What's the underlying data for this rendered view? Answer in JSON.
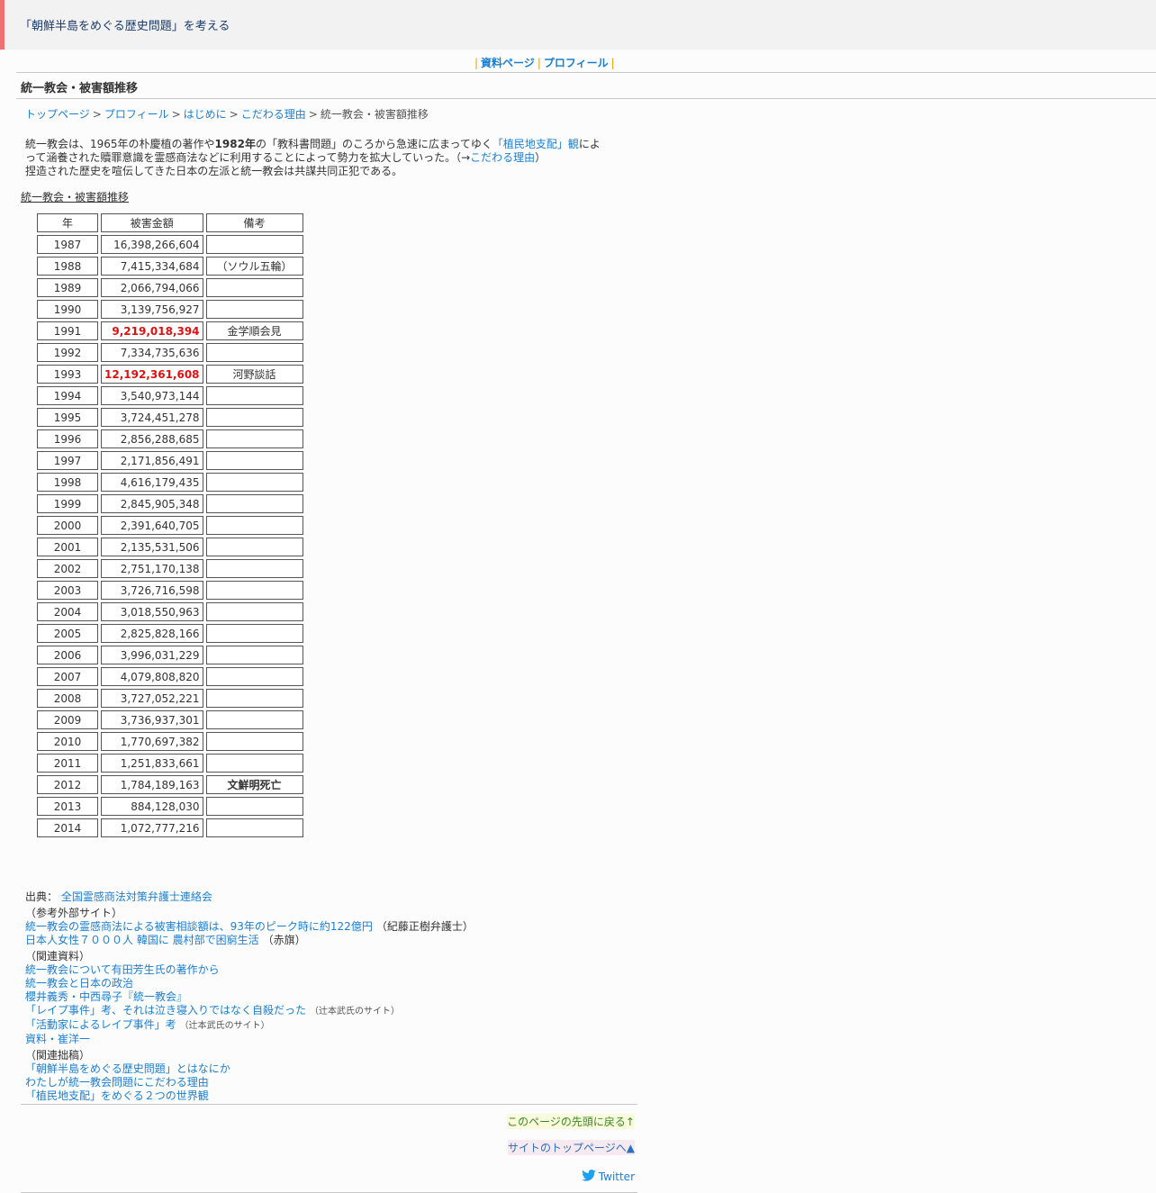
{
  "site": {
    "title": "「朝鮮半島をめぐる歴史問題」を考える"
  },
  "nav": {
    "sep": "|",
    "items": [
      "資料ページ",
      "プロフィール"
    ]
  },
  "page": {
    "heading": "統一教会・被害額推移"
  },
  "breadcrumb": {
    "sep": ">",
    "items": [
      "トップページ",
      "プロフィール",
      "はじめに",
      "こだわる理由"
    ],
    "current": "統一教会・被害額推移"
  },
  "intro": {
    "t1": "統一教会は、1965年の朴慶植の著作や",
    "b1": "1982年",
    "t2": "の「教科書問題」のころから急速に広まってゆく",
    "link1": "「植民地支配」観",
    "t3": "によって涵養された贖罪意識を霊感商法などに利用することによって勢力を拡大していった。（→",
    "link2": "こだわる理由",
    "t4": "）",
    "line3": "捏造された歴史を喧伝してきた日本の左派と統一教会は共謀共同正犯である。"
  },
  "table": {
    "caption": "統一教会・被害額推移",
    "headers": [
      "年",
      "被害金額",
      "備考"
    ],
    "rows": [
      {
        "year": "1987",
        "amount": "16,398,266,604",
        "note": ""
      },
      {
        "year": "1988",
        "amount": "7,415,334,684",
        "note": "（ソウル五輪）"
      },
      {
        "year": "1989",
        "amount": "2,066,794,066",
        "note": ""
      },
      {
        "year": "1990",
        "amount": "3,139,756,927",
        "note": ""
      },
      {
        "year": "1991",
        "amount": "9,219,018,394",
        "note": "金学順会見",
        "highlight": true
      },
      {
        "year": "1992",
        "amount": "7,334,735,636",
        "note": ""
      },
      {
        "year": "1993",
        "amount": "12,192,361,608",
        "note": "河野談話",
        "highlight": true
      },
      {
        "year": "1994",
        "amount": "3,540,973,144",
        "note": ""
      },
      {
        "year": "1995",
        "amount": "3,724,451,278",
        "note": ""
      },
      {
        "year": "1996",
        "amount": "2,856,288,685",
        "note": ""
      },
      {
        "year": "1997",
        "amount": "2,171,856,491",
        "note": ""
      },
      {
        "year": "1998",
        "amount": "4,616,179,435",
        "note": ""
      },
      {
        "year": "1999",
        "amount": "2,845,905,348",
        "note": ""
      },
      {
        "year": "2000",
        "amount": "2,391,640,705",
        "note": ""
      },
      {
        "year": "2001",
        "amount": "2,135,531,506",
        "note": ""
      },
      {
        "year": "2002",
        "amount": "2,751,170,138",
        "note": ""
      },
      {
        "year": "2003",
        "amount": "3,726,716,598",
        "note": ""
      },
      {
        "year": "2004",
        "amount": "3,018,550,963",
        "note": ""
      },
      {
        "year": "2005",
        "amount": "2,825,828,166",
        "note": ""
      },
      {
        "year": "2006",
        "amount": "3,996,031,229",
        "note": ""
      },
      {
        "year": "2007",
        "amount": "4,079,808,820",
        "note": ""
      },
      {
        "year": "2008",
        "amount": "3,727,052,221",
        "note": ""
      },
      {
        "year": "2009",
        "amount": "3,736,937,301",
        "note": ""
      },
      {
        "year": "2010",
        "amount": "1,770,697,382",
        "note": ""
      },
      {
        "year": "2011",
        "amount": "1,251,833,661",
        "note": ""
      },
      {
        "year": "2012",
        "amount": "1,784,189,163",
        "note": "文鮮明死亡",
        "note_bold": true
      },
      {
        "year": "2013",
        "amount": "884,128,030",
        "note": ""
      },
      {
        "year": "2014",
        "amount": "1,072,777,216",
        "note": ""
      }
    ]
  },
  "refs": {
    "source_label": "出典：",
    "source_link": "全国霊感商法対策弁護士連絡会",
    "external_label": "（参考外部サイト）",
    "external": [
      {
        "link": "統一教会の霊感商法による被害相談額は、93年のピーク時に約122億円",
        "note": "（紀藤正樹弁護士）"
      },
      {
        "link": "日本人女性７０００人 韓国に 農村部で困窮生活",
        "note": "（赤旗）"
      }
    ],
    "related_label": "（関連資料）",
    "related": [
      {
        "link": "統一教会について有田芳生氏の著作から",
        "note": ""
      },
      {
        "link": "統一教会と日本の政治",
        "note": ""
      },
      {
        "link": "櫻井義秀・中西尋子『統一教会』",
        "note": ""
      },
      {
        "link": "「レイプ事件」考、それは泣き寝入りではなく自殺だった",
        "note": "（辻本武氏のサイト）"
      },
      {
        "link": "「活動家によるレイプ事件」考",
        "note": "（辻本武氏のサイト）"
      },
      {
        "link": "資料・崔洋一",
        "note": ""
      }
    ],
    "essays_label": "（関連拙稿）",
    "essays": [
      "「朝鮮半島をめぐる歴史問題」とはなにか",
      "わたしが統一教会問題にこだわる理由",
      "「植民地支配」をめぐる２つの世界観"
    ]
  },
  "footer": {
    "back_top": "このページの先頭に戻る↑",
    "to_top": "サイトのトップページへ▲",
    "twitter": "Twitter"
  }
}
